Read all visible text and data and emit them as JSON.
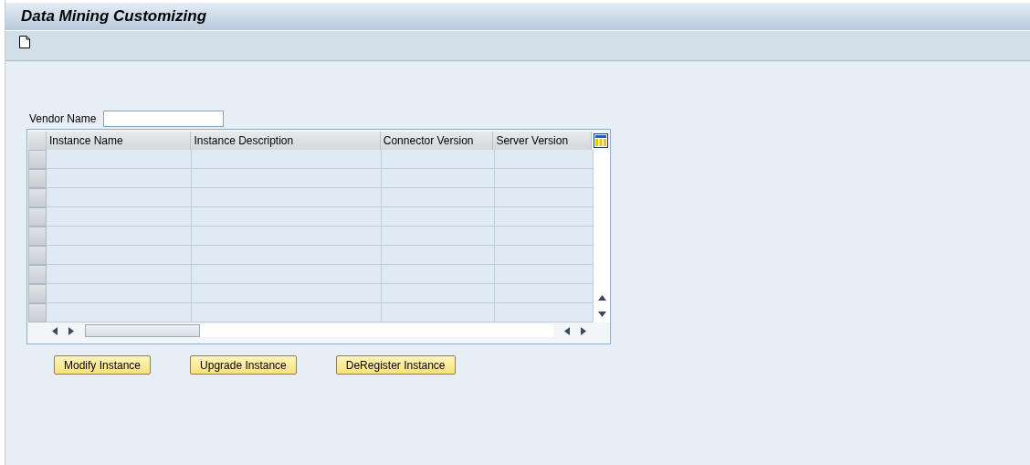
{
  "window": {
    "title": "Data Mining Customizing"
  },
  "form": {
    "vendor_label": "Vendor Name"
  },
  "table": {
    "columns": [
      "Instance Name",
      "Instance Description",
      "Connector Version",
      "Server Version"
    ]
  },
  "buttons": [
    "Modify Instance",
    "Upgrade Instance",
    "DeRegister Instance"
  ]
}
